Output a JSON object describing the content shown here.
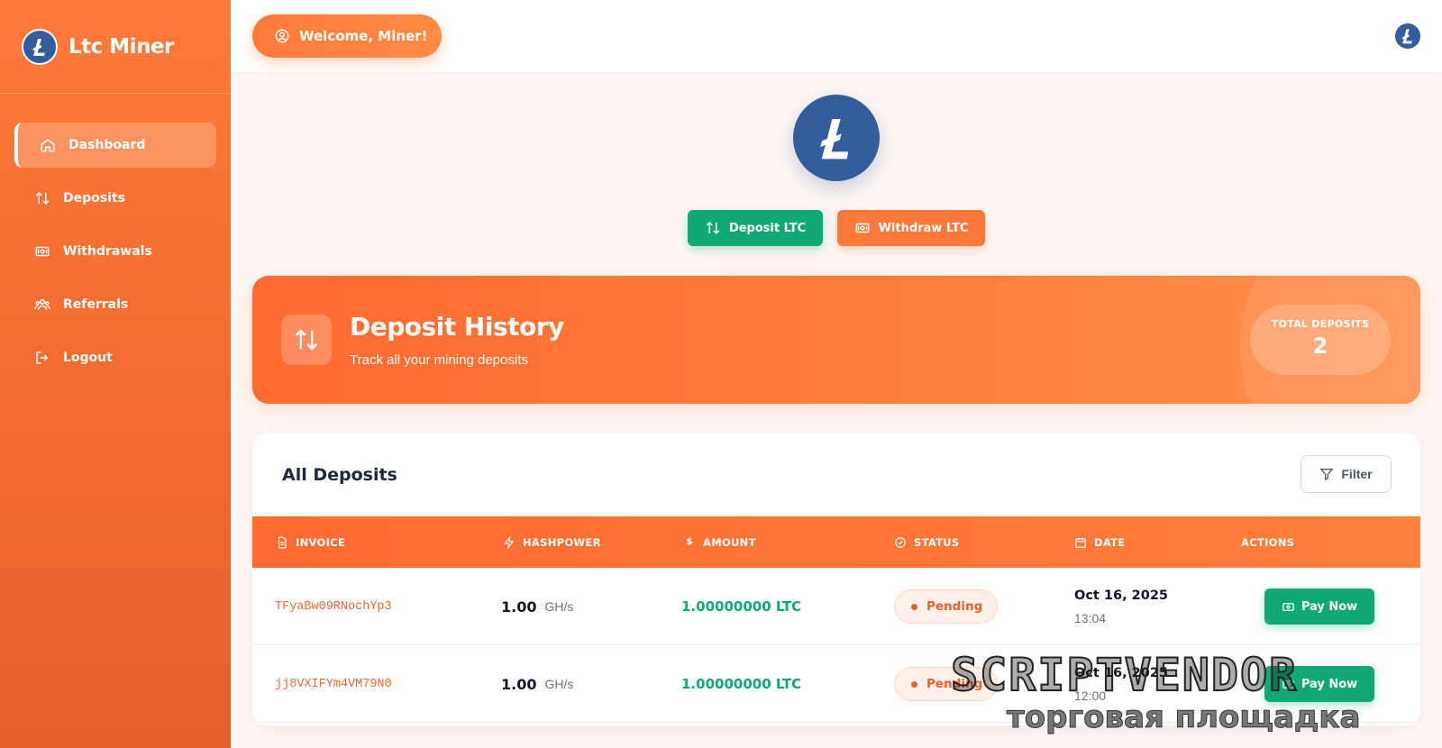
{
  "app": {
    "name": "Ltc Miner"
  },
  "sidebar": {
    "items": [
      {
        "label": "Dashboard",
        "icon": "home-icon",
        "active": true
      },
      {
        "label": "Deposits",
        "icon": "swap-arrows-icon"
      },
      {
        "label": "Withdrawals",
        "icon": "cash-icon"
      },
      {
        "label": "Referrals",
        "icon": "users-icon"
      },
      {
        "label": "Logout",
        "icon": "logout-icon"
      }
    ]
  },
  "topbar": {
    "welcome": "Welcome, Miner!"
  },
  "actions": {
    "deposit": "Deposit LTC",
    "withdraw": "Withdraw LTC"
  },
  "history": {
    "title": "Deposit History",
    "subtitle": "Track all your mining deposits",
    "total_label": "TOTAL DEPOSITS",
    "total_value": "2"
  },
  "deposits": {
    "title": "All Deposits",
    "filter": "Filter",
    "columns": [
      "INVOICE",
      "HASHPOWER",
      "AMOUNT",
      "STATUS",
      "DATE",
      "ACTIONS"
    ],
    "amount_symbol": "$",
    "rows": [
      {
        "invoice": "TFyaBw09RNochYp3",
        "hashpower": "1.00",
        "unit": "GH/s",
        "amount": "1.00000000 LTC",
        "status": "Pending",
        "date": "Oct 16, 2025",
        "time": "13:04",
        "action": "Pay Now"
      },
      {
        "invoice": "jj8VXIFYm4VM79N0",
        "hashpower": "1.00",
        "unit": "GH/s",
        "amount": "1.00000000 LTC",
        "status": "Pending",
        "date": "Oct 16, 2025",
        "time": "12:00",
        "action": "Pay Now"
      }
    ]
  },
  "watermark": {
    "top": "SCRIPTVENDOR",
    "bottom": "торговая площадка"
  },
  "colors": {
    "accent": "#ff7a3a",
    "success": "#10a874",
    "coin": "#345d9d"
  }
}
